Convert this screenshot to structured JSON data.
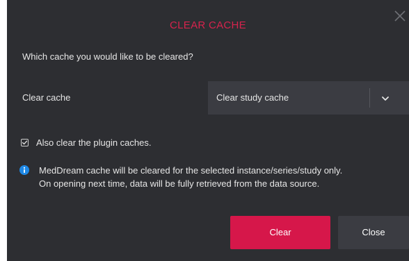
{
  "dialog": {
    "title": "CLEAR CACHE",
    "close_icon": "close-icon",
    "question": "Which cache you would like to be cleared?",
    "cache_label": "Clear cache",
    "cache_select": {
      "selected": "Clear study cache",
      "icon": "chevron-down-icon"
    },
    "plugin_checkbox": {
      "checked": true,
      "label": "Also clear the plugin caches."
    },
    "info": {
      "icon": "info-icon",
      "line1": "MedDream cache will be cleared for the selected instance/series/study only.",
      "line2": "On opening next time, data will be fully retrieved from the data source."
    },
    "buttons": {
      "clear": "Clear",
      "close": "Close"
    }
  },
  "colors": {
    "panel_bg": "#2d2e32",
    "accent": "#d6174a",
    "title": "#d6234d",
    "info_icon": "#1e88e5",
    "secondary_bg": "#3b3c42"
  }
}
